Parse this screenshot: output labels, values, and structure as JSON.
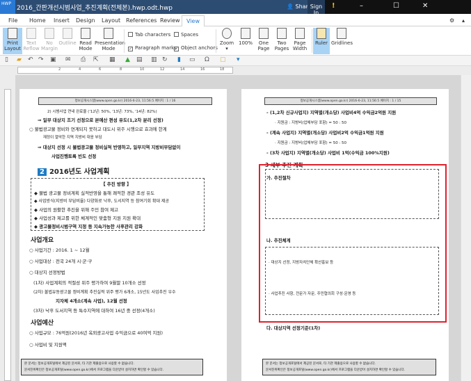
{
  "window": {
    "logo": "HWP",
    "title": "2016_간판개선시범사업_추진계획(전체본).hwp.odt.hwp",
    "share": "Share",
    "sign_in": "Sign In",
    "warn": "!",
    "min": "–",
    "max": "☐",
    "close": "✕"
  },
  "tabs": [
    "File",
    "Home",
    "Insert",
    "Design",
    "Layout",
    "References",
    "Review",
    "View"
  ],
  "ribbon": {
    "views": [
      {
        "l1": "Print",
        "l2": "Layout",
        "state": "selected"
      },
      {
        "l1": "Text",
        "l2": "Reflow",
        "state": "disabled"
      },
      {
        "l1": "No",
        "l2": "Margin",
        "state": "disabled"
      },
      {
        "l1": "Outline",
        "l2": "",
        "state": "disabled"
      },
      {
        "l1": "Read",
        "l2": "Mode",
        "state": "normal"
      },
      {
        "l1": "Presentation",
        "l2": "Mode",
        "state": "normal"
      }
    ],
    "checks": [
      {
        "label": "Tab characters",
        "checked": false
      },
      {
        "label": "Spaces",
        "checked": false
      },
      {
        "label": "Paragraph marks",
        "checked": true
      },
      {
        "label": "Object anchors",
        "checked": true
      }
    ],
    "zoom": [
      {
        "l1": "Zoom",
        "l2": "▾"
      },
      {
        "l1": "100%",
        "l2": ""
      },
      {
        "l1": "One",
        "l2": "Page"
      },
      {
        "l1": "Two",
        "l2": "Pages"
      },
      {
        "l1": "Page",
        "l2": "Width"
      }
    ],
    "show": [
      {
        "l1": "Ruler",
        "state": "selected"
      },
      {
        "l1": "Gridlines",
        "state": "normal"
      }
    ]
  },
  "ruler_ticks": [
    "2",
    "4",
    "6",
    "8",
    "10",
    "12",
    "14",
    "16",
    "18"
  ],
  "page1": {
    "header": "정보공개시스템(www.open.go.kr) 2016-6-23, 11:56:5 페이지 : 1 / 16",
    "lines": [
      "2) 시범사업 연내 완료율 ('12년: 50%, '13년: 73%, '14년: 82%)",
      "⇒ 일부 대상지 조기 선정으로 본예산 편성 유도(1,2차 분리 선정)",
      "○ 불법광고물 정비와 연계되지 못하고 대도시 위주 시행으로 효과에 한계",
      "재정이 열악한 지역 지방비 대응 부담",
      "⇒ 대상지 선정 시 불법광고물 정비실적 반영하고, 일부지역 지방비부담없이",
      "사업진행토록 빈도 선정"
    ],
    "section_num": "2",
    "section_title": "2016년도 사업계획",
    "box_title": "【 추진 방향 】",
    "box_items": [
      "◆ 불법 광고물 정비계획 실적반영을 통해 쾌적한 경관 조성 유도",
      "◆ 사업방식(지방비 부담비율) 다양화로 낙후, 도서지역 등 참여기회 확대 제공",
      "◆ 사업의 원활한 추진을 위해 주민 참여 제고",
      "◆ 사업성과 제고를 위한 체계적인 맞춤형 지원 지원 확대",
      "◆ 광고물정비시범구역 지정 등 지속가능한 사후관리 강화"
    ],
    "overview_title": "사업개요",
    "overview": [
      "○ 사업기간 : 2016. 1 ~ 12월",
      "○ 사업대상 : 전국 24개 시·군·구",
      "○ 대상지 선정방법"
    ],
    "selection": [
      "(1차) 사업계획의 적절성 위주 평가하여 9월말 10개소 선정",
      "(2차) 불법유동광고물 정비계획 추진실적 위주 평가 6개소, 15년도 사업추진 우수",
      "지자체 4개소(계속 사업), 12월 선정",
      "(3차) 낙후 도서지역 등 특수지역에 대하여 16년 중 선정(4개소)"
    ],
    "budget_title": "사업예산",
    "budget": [
      "○ 사업규모 : 76억원(2016년 옥외광고사업 수익금으로 40여억 지원)",
      "○ 사업비 및 지원액"
    ],
    "footer": [
      "본 문서는 정보공개포털에서 제공된 문서로, 타 기관 제출용으로 사용할 수 없습니다.",
      "문서진위확인은 정보공개포털(www.open.go.kr)에서 프로그램을 다운받아 설치하면 확인할 수 있습니다."
    ]
  },
  "page2": {
    "header": "정보공개시스템(www.open.go.kr) 2016-6-23, 11:56:5 페이지 : 1 / 15",
    "lines": [
      "- (1,2차 신규사업지) 지역별(개소당) 사업비4억 수익금2억원 지원",
      "· 지원금 : 지방비(업체부담 포함) = 50 : 50",
      "- (계속 사업지) 지역별(개소당) 사업비2억 수익금1억원 지원",
      "· 지원금 : 지방비(업체부담 포함) = 50 : 50",
      "- (3차 사업지) 지역별(개소당) 사업비 1억(수익금 100%지원)"
    ],
    "section": "3 세부 추진 계획",
    "sub_a": "가. 추진절차",
    "sub_b": "나. 추진체계",
    "box_b": [
      "· 대상지 선정, 지방자치단체 확산홍보 등",
      "· 사업추진 사항, 전문가 자문, 주민협의회 구성·운영 등"
    ],
    "sub_c": "다. 대상지역 선정기준(1차)",
    "footer": [
      "본 문서는 정보공개포털에서 제공된 문서로, 타 기관 제출용으로 사용할 수 없습니다.",
      "문서진위확인은 정보공개포털(www.open.go.kr)에서 프로그램을 다운받아 설치하면 확인할 수 있습니다."
    ]
  },
  "colors": {
    "titlebar": "#2d4c72",
    "accent": "#2a7ad5",
    "highlight": "#e0202c"
  }
}
